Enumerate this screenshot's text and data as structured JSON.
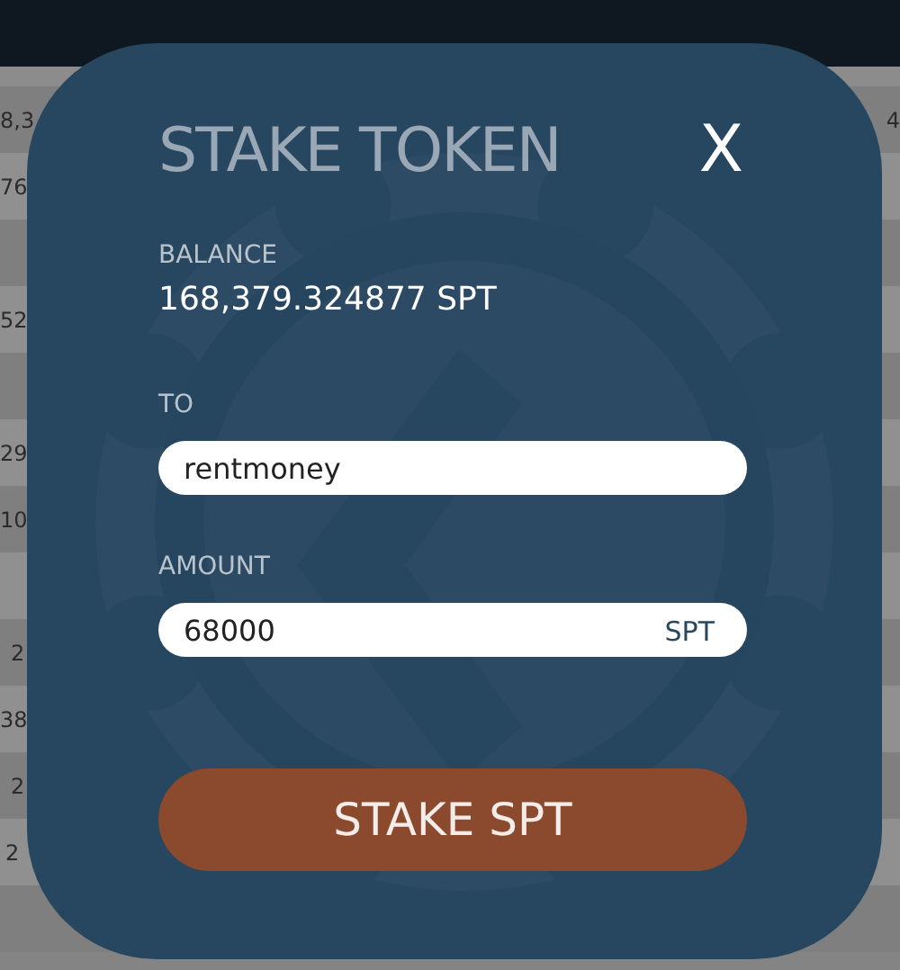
{
  "background_table": {
    "rows": [
      {
        "column_1": "8,3",
        "column_2": "4"
      },
      {
        "column_1": "76"
      },
      {
        "column_1": ""
      },
      {
        "column_1": "52"
      },
      {
        "column_1": ""
      },
      {
        "column_1": "29"
      },
      {
        "column_1": "10"
      },
      {
        "column_1": ""
      },
      {
        "column_1": "2"
      },
      {
        "column_1": "38"
      },
      {
        "column_1": "2"
      },
      {
        "column_1": "2"
      },
      {
        "column_1": ""
      }
    ]
  },
  "modal": {
    "title": "STAKE TOKEN",
    "close": "X",
    "balance": {
      "label": "BALANCE",
      "value": "168,379.324877 SPT"
    },
    "to": {
      "label": "TO",
      "value": "rentmoney"
    },
    "amount": {
      "label": "AMOUNT",
      "value": "68000",
      "unit": "SPT"
    },
    "button": "STAKE SPT"
  }
}
